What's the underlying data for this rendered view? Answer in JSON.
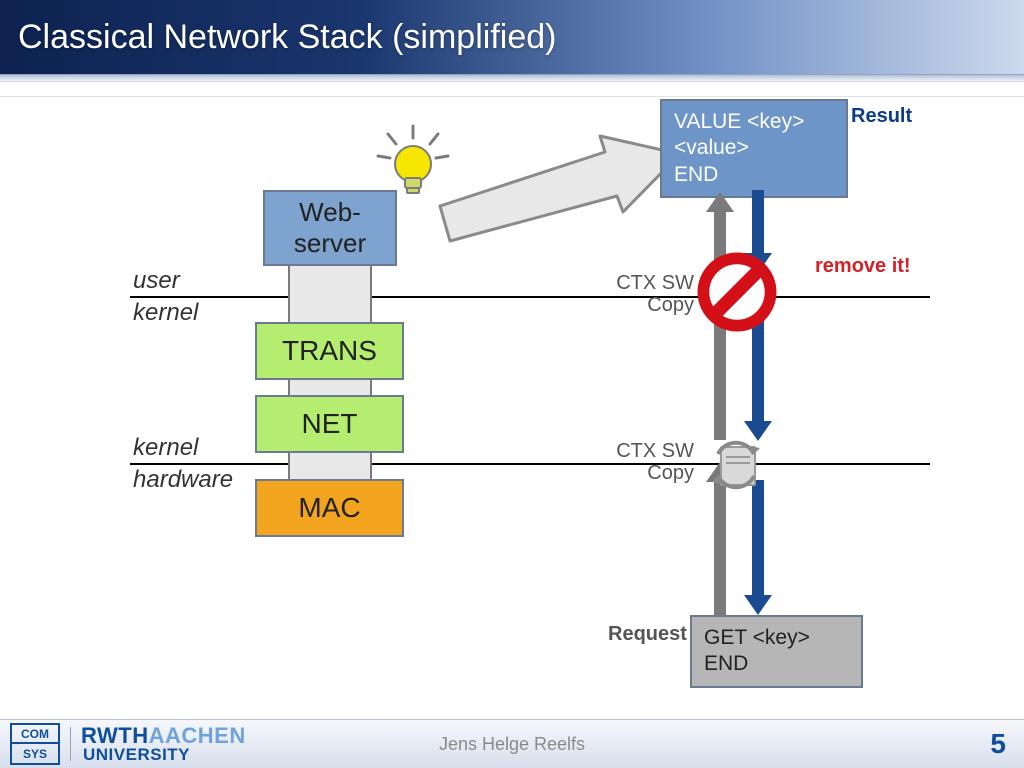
{
  "title": "Classical Network Stack (simplified)",
  "boundaries": {
    "user": "user",
    "kernel_top": "kernel",
    "kernel_bottom": "kernel",
    "hardware": "hardware"
  },
  "stack": {
    "web_server": "Web-\nserver",
    "trans": "TRANS",
    "net": "NET",
    "mac": "MAC"
  },
  "labels": {
    "result": "Result",
    "remove_it": "remove it!",
    "request": "Request",
    "ctx_sw": "CTX SW",
    "copy": "Copy"
  },
  "messages": {
    "result_box": "VALUE <key>\n<value>\nEND",
    "request_box": "GET <key>\nEND"
  },
  "footer": {
    "author": "Jens Helge Reelfs",
    "page": "5",
    "comsys_top": "COM",
    "comsys_bottom": "SYS",
    "rwth": "RWTH",
    "aachen": "AACHEN",
    "university": "UNIVERSITY"
  }
}
